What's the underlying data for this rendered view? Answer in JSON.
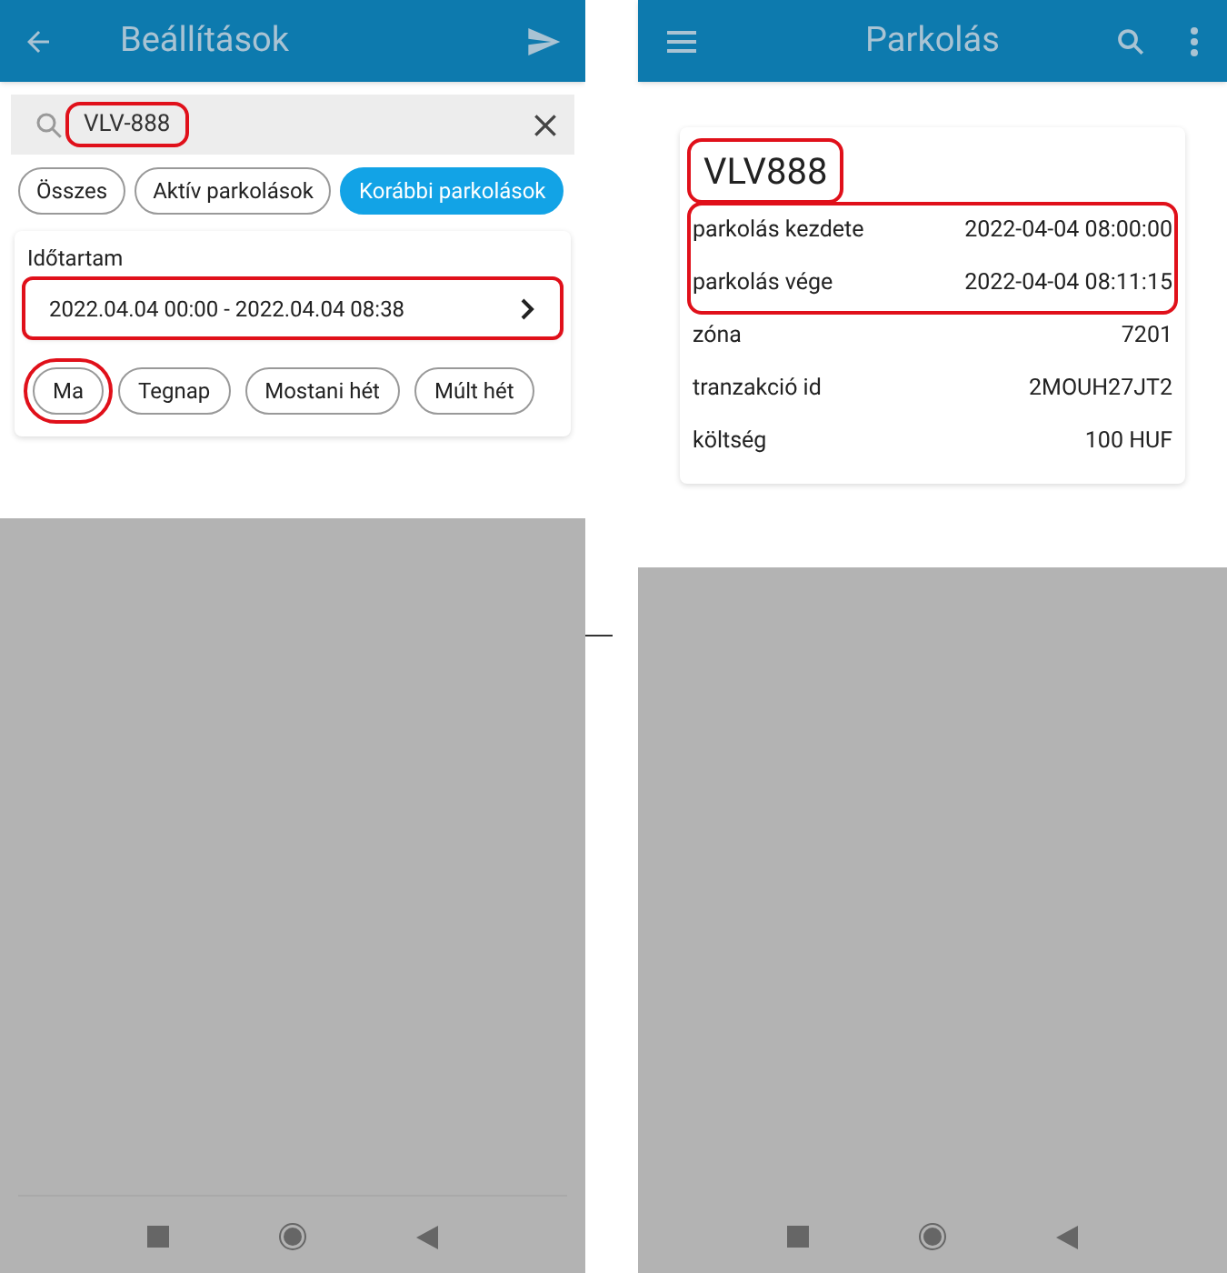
{
  "left_screen": {
    "app_bar": {
      "title": "Beállítások"
    },
    "search": {
      "value": "VLV-888",
      "highlighted": true
    },
    "filter_chips": [
      {
        "label": "Összes",
        "selected": false
      },
      {
        "label": "Aktív parkolások",
        "selected": false
      },
      {
        "label": "Korábbi parkolások",
        "selected": true
      }
    ],
    "period": {
      "label": "Időtartam",
      "range": "2022.04.04 00:00 - 2022.04.04 08:38",
      "highlighted": true,
      "quick_chips": [
        {
          "label": "Ma",
          "selected": false,
          "highlighted": true
        },
        {
          "label": "Tegnap",
          "selected": false,
          "highlighted": false
        },
        {
          "label": "Mostani hét",
          "selected": false,
          "highlighted": false
        },
        {
          "label": "Múlt hét",
          "selected": false,
          "highlighted": false
        }
      ]
    }
  },
  "right_screen": {
    "app_bar": {
      "title": "Parkolás"
    },
    "parking": {
      "plate": "VLV888",
      "plate_highlighted": true,
      "rows": [
        {
          "label": "parkolás kezdete",
          "value": "2022-04-04 08:00:00",
          "highlighted": true
        },
        {
          "label": "parkolás vége",
          "value": "2022-04-04 08:11:15",
          "highlighted": true
        },
        {
          "label": "zóna",
          "value": "7201",
          "highlighted": false
        },
        {
          "label": "tranzakció id",
          "value": "2MOUH27JT2",
          "highlighted": false
        },
        {
          "label": "költség",
          "value": "100 HUF",
          "highlighted": false
        }
      ]
    }
  }
}
